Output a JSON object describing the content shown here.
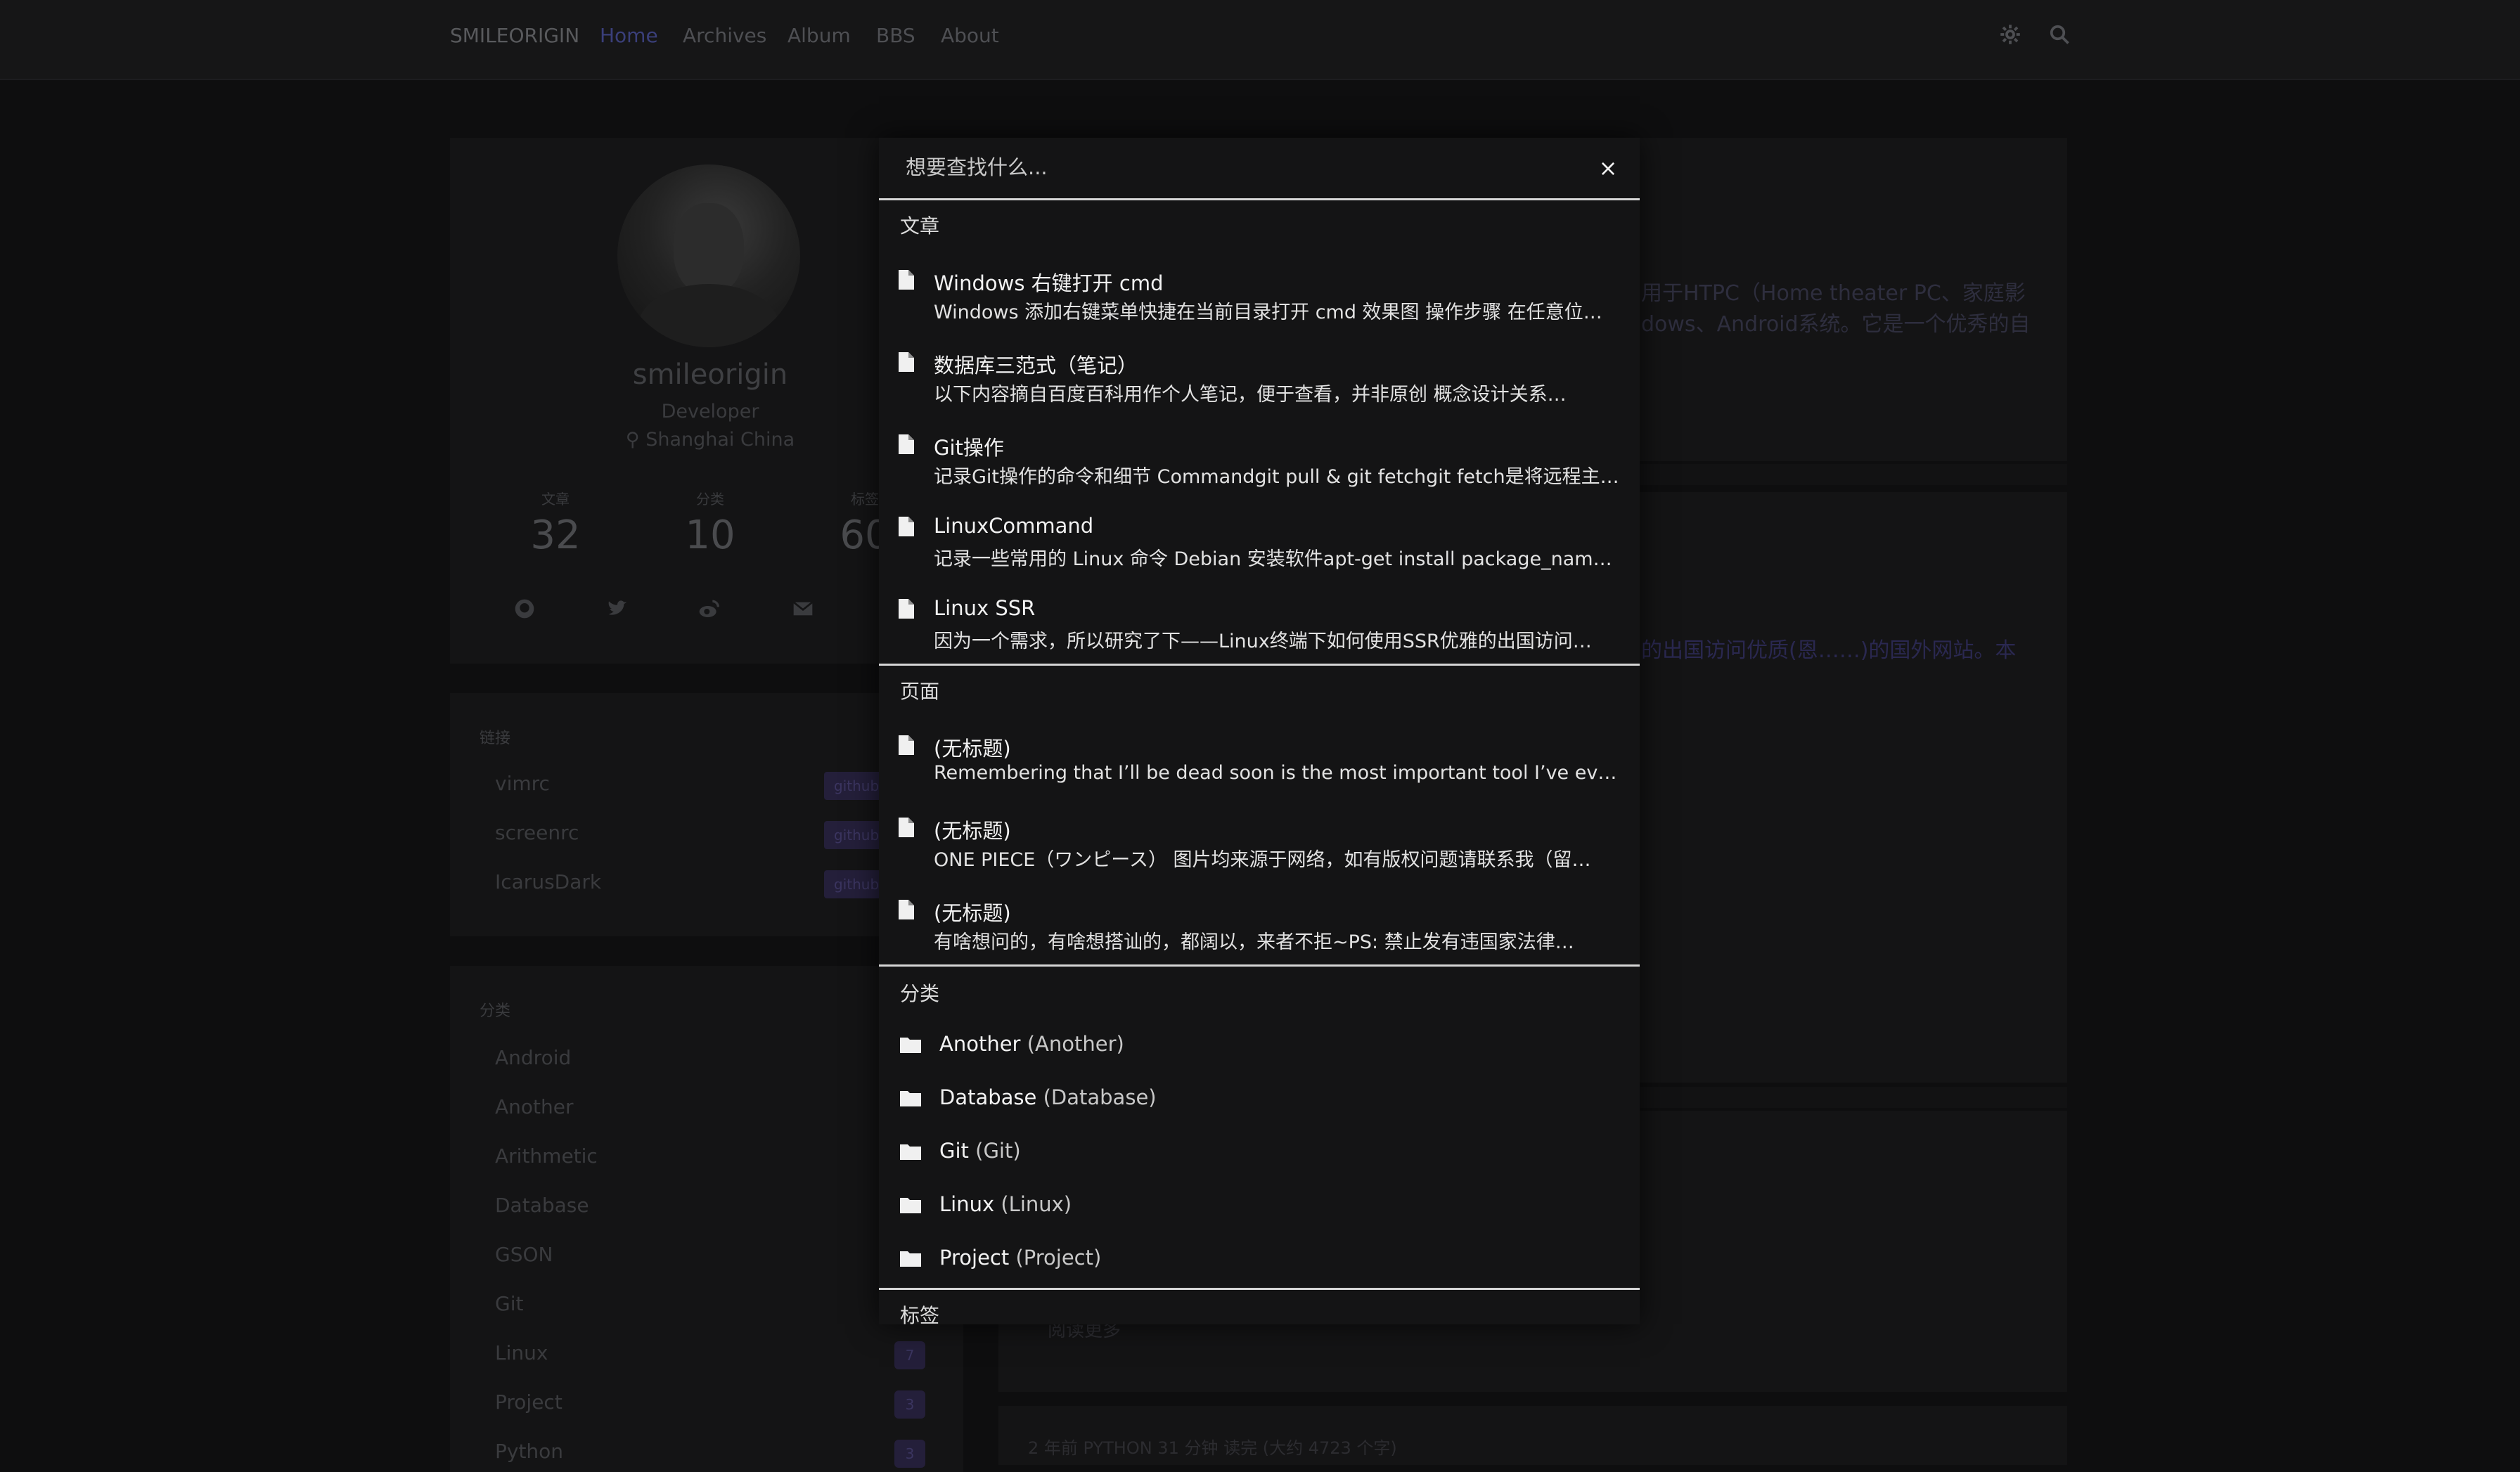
{
  "nav": {
    "brand": "SMILEORIGIN",
    "links": [
      "Home",
      "Archives",
      "Album",
      "BBS",
      "About"
    ],
    "icons": [
      "settings-icon",
      "search-icon"
    ]
  },
  "profile": {
    "name": "smileorigin",
    "role": "Developer",
    "location": "Shanghai China",
    "stats": [
      {
        "label": "文章",
        "value": "32"
      },
      {
        "label": "分类",
        "value": "10"
      },
      {
        "label": "标签",
        "value": "60"
      }
    ],
    "social_icons": [
      "github-icon",
      "twitter-icon",
      "weibo-icon",
      "mail-icon"
    ]
  },
  "links_widget": {
    "title": "链接",
    "items": [
      {
        "label": "vimrc",
        "badge": "github"
      },
      {
        "label": "screenrc",
        "badge": "github"
      },
      {
        "label": "IcarusDark",
        "badge": "github"
      }
    ]
  },
  "categories_widget": {
    "title": "分类",
    "items": [
      {
        "label": "Android",
        "count": ""
      },
      {
        "label": "Another",
        "count": ""
      },
      {
        "label": "Arithmetic",
        "count": ""
      },
      {
        "label": "Database",
        "count": ""
      },
      {
        "label": "GSON",
        "count": ""
      },
      {
        "label": "Git",
        "count": ""
      },
      {
        "label": "Linux",
        "count": "7"
      },
      {
        "label": "Project",
        "count": "3"
      },
      {
        "label": "Python",
        "count": "3"
      }
    ]
  },
  "background_posts": {
    "excerpt1_line1": "用于HTPC（Home theater PC、家庭影",
    "excerpt1_line2": "dows、Android系统。它是一个优秀的自",
    "excerpt2": "的出国访问优质(恩……)的国外网站。本",
    "read_more": "阅读更多",
    "meta": "2 年前   PYTHON   31 分钟 读完 (大约 4723 个字)"
  },
  "search": {
    "placeholder": "想要查找什么...",
    "close_label": "×",
    "groups": {
      "posts": {
        "title": "文章",
        "items": [
          {
            "title": "Windows 右键打开 cmd",
            "desc": "Windows 添加右键菜单快捷在当前目录打开 cmd 效果图 操作步骤 在任意位…"
          },
          {
            "title": "数据库三范式（笔记）",
            "desc": "以下内容摘自百度百科用作个人笔记，便于查看，并非原创 概念设计关系…"
          },
          {
            "title": "Git操作",
            "desc": "记录Git操作的命令和细节 Commandgit pull & git fetchgit fetch是将远程主…"
          },
          {
            "title": "LinuxCommand",
            "desc": "记录一些常用的 Linux 命令 Debian 安装软件apt-get install package_name…"
          },
          {
            "title": "Linux SSR",
            "desc": "因为一个需求，所以研究了下——Linux终端下如何使用SSR优雅的出国访问…"
          }
        ]
      },
      "pages": {
        "title": "页面",
        "items": [
          {
            "title": "(无标题)",
            "desc": "Remembering that I’ll be dead soon is the most important tool I’ve ever en…"
          },
          {
            "title": "(无标题)",
            "desc": "ONE PIECE（ワンピース） 图片均来源于网络，如有版权问题请联系我（留…"
          },
          {
            "title": "(无标题)",
            "desc": "有啥想问的，有啥想搭讪的，都阔以，来者不拒~PS: 禁止发有违国家法律…"
          }
        ]
      },
      "categories": {
        "title": "分类",
        "items": [
          {
            "name": "Another",
            "slug": "(Another)"
          },
          {
            "name": "Database",
            "slug": "(Database)"
          },
          {
            "name": "Git",
            "slug": "(Git)"
          },
          {
            "name": "Linux",
            "slug": "(Linux)"
          },
          {
            "name": "Project",
            "slug": "(Project)"
          }
        ]
      },
      "tags": {
        "title": "标签"
      }
    }
  }
}
